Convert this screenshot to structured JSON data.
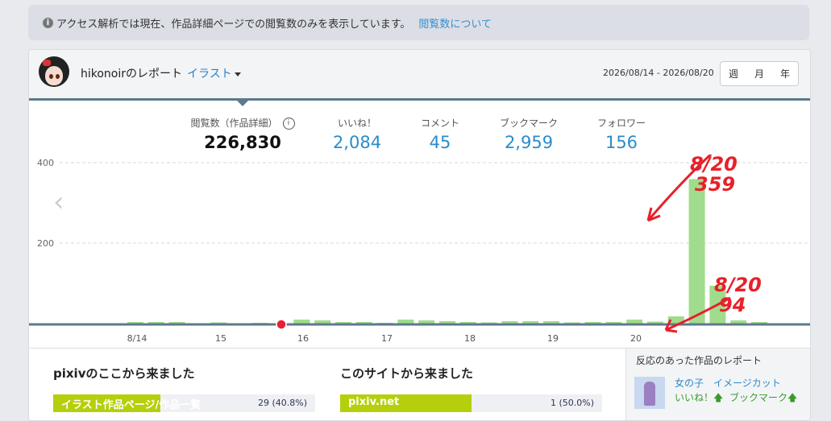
{
  "notice": {
    "text": "アクセス解析では現在、作品詳細ページでの閲覧数のみを表示しています。",
    "link": "閲覧数について"
  },
  "header": {
    "title": "hikonoirのレポート",
    "category": "イラスト",
    "date_range": "2026/08/14 - 2026/08/20",
    "periods": [
      "週",
      "月",
      "年"
    ]
  },
  "stats": [
    {
      "label": "閲覧数（作品詳細）",
      "value": "226,830"
    },
    {
      "label": "いいね！",
      "value": "2,084"
    },
    {
      "label": "コメント",
      "value": "45"
    },
    {
      "label": "ブックマーク",
      "value": "2,959"
    },
    {
      "label": "フォロワー",
      "value": "156"
    }
  ],
  "chart_data": {
    "type": "bar",
    "ytick_labels": [
      "400",
      "200"
    ],
    "x_tick_labels": [
      "8/14",
      "15",
      "16",
      "17",
      "18",
      "19",
      "20"
    ],
    "ylim": [
      0,
      400
    ],
    "grid": true,
    "values": [
      4,
      4,
      4,
      0,
      3,
      0,
      2,
      0,
      10,
      8,
      4,
      4,
      2,
      10,
      8,
      6,
      4,
      3,
      6,
      6,
      6,
      3,
      4,
      4,
      10,
      5,
      18,
      359,
      94,
      8,
      4,
      0
    ],
    "nav_prev": "‹",
    "annotations": [
      {
        "text_line1": "8/20",
        "text_line2": "359",
        "color": "#e8202a"
      },
      {
        "text_line1": "8/20",
        "text_line2": "94",
        "color": "#e8202a"
      }
    ],
    "bar_color": "#a0dc8c",
    "marker_color": "#e8203a"
  },
  "bottom": {
    "pixiv_title": "pixivのここから来ました",
    "pixiv_item": "イラスト作品ページ/作品一覧",
    "pixiv_count": "29 (40.8%)",
    "pixiv_pct": 40.8,
    "site_title": "このサイトから来ました",
    "site_item": "pixiv.net",
    "site_count": "1 (50.0%)",
    "site_pct": 50.0
  },
  "side": {
    "title": "反応のあった作品のレポート",
    "work_name": "女の子　イメージカット",
    "like_label": "いいね！",
    "bookmark_label": "ブックマーク",
    "arrow": "🡅"
  }
}
